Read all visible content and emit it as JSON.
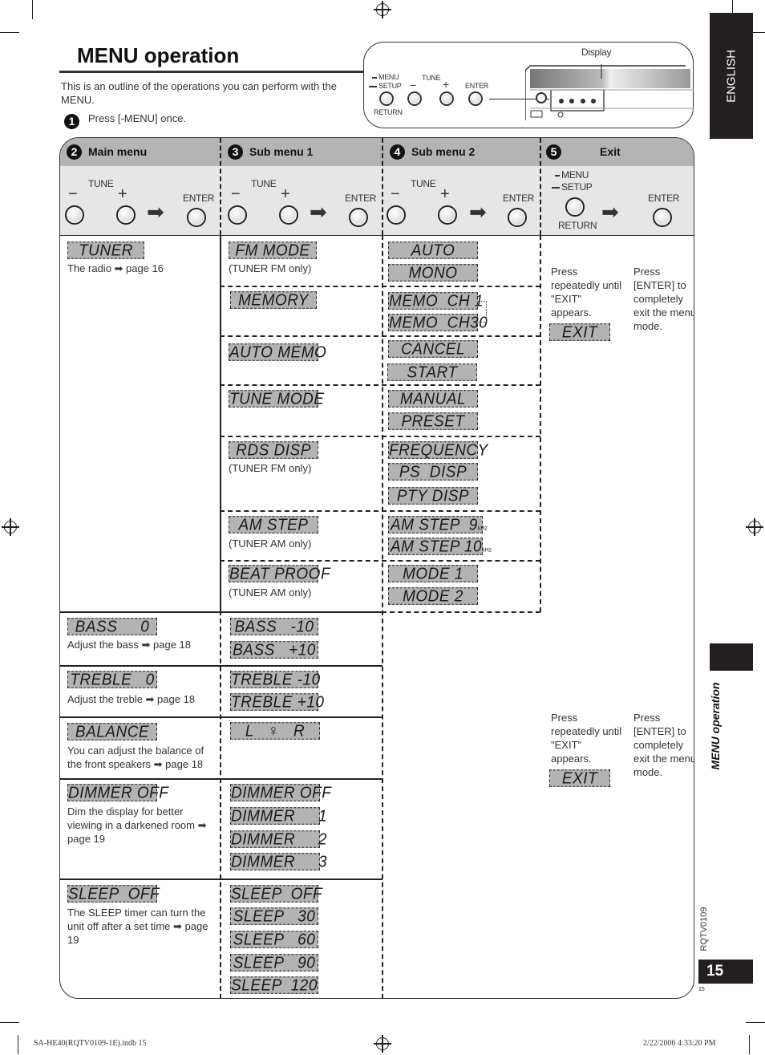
{
  "page": {
    "title": "MENU operation",
    "intro": "This is an outline of the operations you can perform with the MENU.",
    "step1": {
      "num": "1",
      "text": "Press [-MENU] once."
    },
    "language_tab": "ENGLISH",
    "side_label": "MENU operation",
    "doc_code": "RQTV0109",
    "page_number": "15",
    "page_number_small": "15",
    "footer_left": "SA-HE40(RQTV0109-1E).indb   15",
    "footer_right": "2/22/2006   4:33:20 PM"
  },
  "panel": {
    "display_label": "Display",
    "menu": "MENU",
    "setup": "SETUP",
    "return": "RETURN",
    "tune": "TUNE",
    "minus": "−",
    "plus": "+",
    "enter": "ENTER"
  },
  "columns": [
    {
      "num": "2",
      "label": "Main menu"
    },
    {
      "num": "3",
      "label": "Sub menu 1"
    },
    {
      "num": "4",
      "label": "Sub menu 2"
    },
    {
      "num": "5",
      "label": "Exit"
    }
  ],
  "controls": {
    "tune": "TUNE",
    "minus": "−",
    "plus": "+",
    "enter": "ENTER",
    "arrow": "➡",
    "menu": "MENU",
    "setup": "SETUP",
    "return": "RETURN"
  },
  "rows": {
    "tuner": {
      "main": "TUNER",
      "main_note": "The radio ➡ page 16",
      "fm_mode": {
        "label": "FM MODE",
        "note": "(TUNER FM only)",
        "options": [
          "AUTO",
          "MONO"
        ]
      },
      "memory": {
        "label": "MEMORY",
        "options": [
          "MEMO  CH 1",
          "MEMO  CH30"
        ]
      },
      "auto_memo": {
        "label": "AUTO MEMO",
        "options": [
          "CANCEL",
          "START"
        ]
      },
      "tune_mode": {
        "label": "TUNE MODE",
        "options": [
          "MANUAL",
          "PRESET"
        ]
      },
      "rds_disp": {
        "label": "RDS DISP",
        "note": "(TUNER FM only)",
        "options": [
          "FREQUENCY",
          "PS  DISP",
          "PTY DISP"
        ]
      },
      "am_step": {
        "label": "AM STEP",
        "note": "(TUNER AM only)",
        "options": [
          "AM STEP  9",
          "AM STEP 10"
        ],
        "unit": "kHz"
      },
      "beat_proof": {
        "label": "BEAT PROOF",
        "note": "(TUNER AM only)",
        "options": [
          "MODE 1",
          "MODE 2"
        ]
      },
      "exit_note_a": "Press repeatedly until \"EXIT\" appears.",
      "exit_note_b": "Press [ENTER] to completely exit the menu mode.",
      "exit_label": "EXIT"
    },
    "bass": {
      "main": "BASS     0",
      "note": "Adjust the bass ➡ page 18",
      "options": [
        "BASS   -10",
        "BASS   +10"
      ]
    },
    "treble": {
      "main": "TREBLE   0",
      "note": "Adjust the treble ➡ page 18",
      "options": [
        "TREBLE -10",
        "TREBLE +10"
      ]
    },
    "balance": {
      "main": "BALANCE",
      "note": "You can adjust the balance of the front speakers ➡ page 18",
      "options": [
        "L   ♀   R"
      ],
      "exit_note_a": "Press repeatedly until \"EXIT\" appears.",
      "exit_note_b": "Press [ENTER] to completely exit the menu mode.",
      "exit_label": "EXIT"
    },
    "dimmer": {
      "main": "DIMMER OFF",
      "note": "Dim the display for better viewing in a darkened room ➡ page 19",
      "options": [
        "DIMMER OFF",
        "DIMMER     1",
        "DIMMER     2",
        "DIMMER     3"
      ]
    },
    "sleep": {
      "main": "SLEEP  OFF",
      "note": "The SLEEP timer can turn the unit off after a set time ➡ page 19",
      "options": [
        "SLEEP  OFF",
        "SLEEP   30",
        "SLEEP   60",
        "SLEEP   90",
        "SLEEP  120"
      ]
    }
  }
}
